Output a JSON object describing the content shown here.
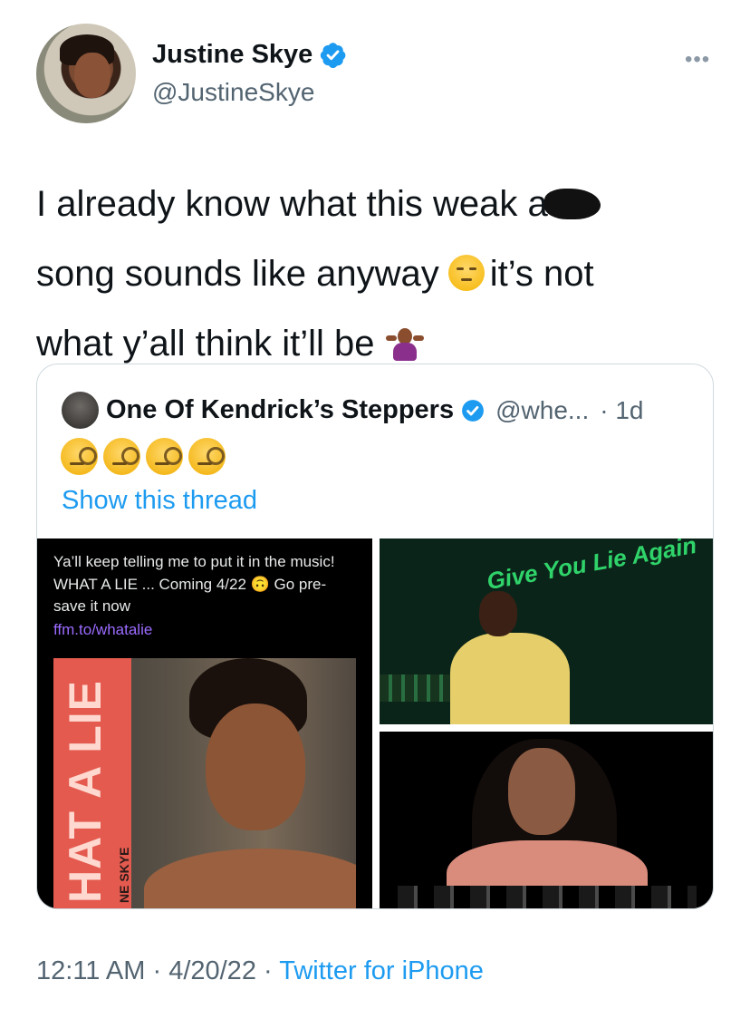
{
  "author": {
    "name": "Justine Skye",
    "handle": "@JustineSkye",
    "verified": true,
    "avatar_icon": "profile-photo"
  },
  "more_icon": "more-horizontal-icon",
  "tweet": {
    "lines": [
      "I already know what this weak a",
      "song sounds like anyway",
      "it’s not",
      "what y’all think it’ll be"
    ],
    "emojis": [
      "unamused-face-emoji",
      "person-shrugging-emoji"
    ]
  },
  "quoted": {
    "name": "One Of Kendrick’s Steppers",
    "handle": "@whe...",
    "time": "· 1d",
    "verified": true,
    "emoji_row": [
      "face-with-monocle",
      "face-with-monocle",
      "face-with-monocle",
      "face-with-monocle"
    ],
    "show_thread": "Show this thread",
    "media": {
      "left_text": "Ya’ll keep telling me to put it in the music! WHAT A LIE ... Coming 4/22 🙃 Go pre-save it now",
      "left_link": "ffm.to/whatalie",
      "cover_title": "HAT A LIE",
      "cover_artist": "NE SKYE",
      "top_right_text": "Give You Lie Again"
    }
  },
  "footer": {
    "time": "12:11 AM",
    "sep1": "·",
    "date": "4/20/22",
    "sep2": "·",
    "source": "Twitter for iPhone"
  },
  "colors": {
    "link": "#1d9bf0",
    "secondary_text": "#536471",
    "border": "#cfd9de",
    "verified": "#1d9bf0"
  }
}
